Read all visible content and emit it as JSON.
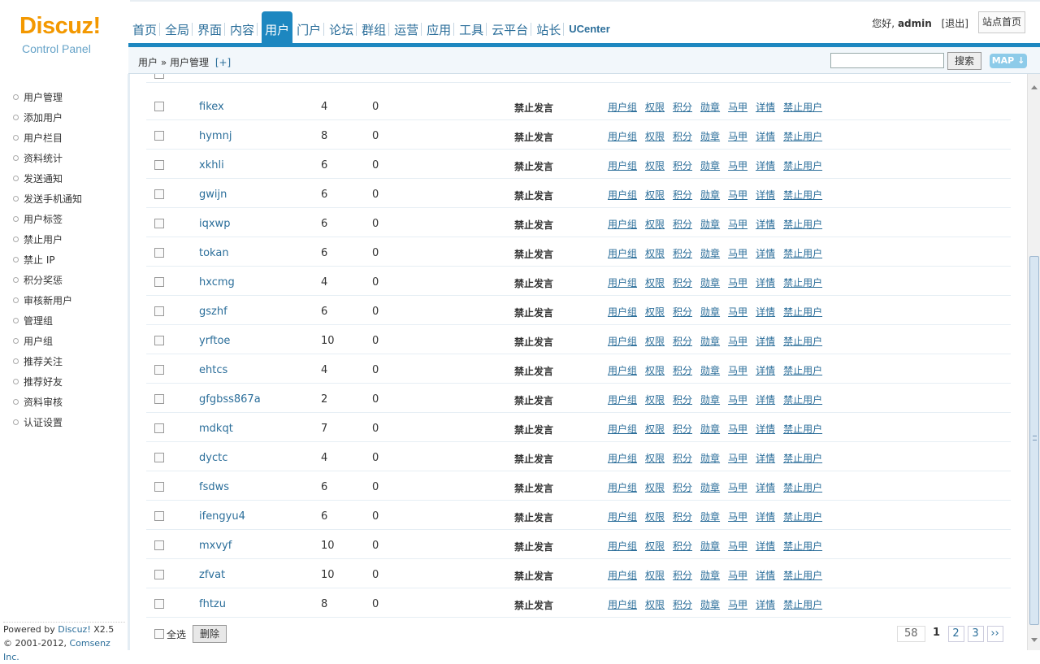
{
  "logo": {
    "brand": "Discuz!",
    "subtitle": "Control Panel"
  },
  "nav": [
    {
      "label": "首页"
    },
    {
      "label": "全局"
    },
    {
      "label": "界面"
    },
    {
      "label": "内容"
    },
    {
      "label": "用户",
      "active": true
    },
    {
      "label": "门户"
    },
    {
      "label": "论坛"
    },
    {
      "label": "群组"
    },
    {
      "label": "运营"
    },
    {
      "label": "应用"
    },
    {
      "label": "工具"
    },
    {
      "label": "云平台"
    },
    {
      "label": "站长"
    },
    {
      "label": "UCenter"
    }
  ],
  "user": {
    "greeting": "您好,",
    "name": "admin",
    "logout": "[退出]",
    "site_home": "站点首页"
  },
  "breadcrumb": {
    "path": "用户 » 用户管理",
    "add": "[+]"
  },
  "search": {
    "button": "搜索",
    "map": "MAP"
  },
  "left_menu": [
    "用户管理",
    "添加用户",
    "用户栏目",
    "资料统计",
    "发送通知",
    "发送手机通知",
    "用户标签",
    "禁止用户",
    "禁止 IP",
    "积分奖惩",
    "审核新用户",
    "管理组",
    "用户组",
    "推荐关注",
    "推荐好友",
    "资料审核",
    "认证设置"
  ],
  "powered": {
    "line1_prefix": "Powered by ",
    "product": "Discuz!",
    "version": " X2.5",
    "line2_prefix": "© 2001-2012, ",
    "company": "Comsenz Inc."
  },
  "ops_labels": [
    "用户组",
    "权限",
    "积分",
    "勋章",
    "马甲",
    "详情",
    "禁止用户"
  ],
  "rows": [
    {
      "name": "fikex",
      "c1": "4",
      "c2": "0",
      "status": "禁止发言"
    },
    {
      "name": "hymnj",
      "c1": "8",
      "c2": "0",
      "status": "禁止发言"
    },
    {
      "name": "xkhli",
      "c1": "6",
      "c2": "0",
      "status": "禁止发言"
    },
    {
      "name": "gwijn",
      "c1": "6",
      "c2": "0",
      "status": "禁止发言"
    },
    {
      "name": "iqxwp",
      "c1": "6",
      "c2": "0",
      "status": "禁止发言"
    },
    {
      "name": "tokan",
      "c1": "6",
      "c2": "0",
      "status": "禁止发言"
    },
    {
      "name": "hxcmg",
      "c1": "4",
      "c2": "0",
      "status": "禁止发言"
    },
    {
      "name": "gszhf",
      "c1": "6",
      "c2": "0",
      "status": "禁止发言"
    },
    {
      "name": "yrftoe",
      "c1": "10",
      "c2": "0",
      "status": "禁止发言"
    },
    {
      "name": "ehtcs",
      "c1": "4",
      "c2": "0",
      "status": "禁止发言"
    },
    {
      "name": "gfgbss867a",
      "c1": "2",
      "c2": "0",
      "status": "禁止发言"
    },
    {
      "name": "mdkqt",
      "c1": "7",
      "c2": "0",
      "status": "禁止发言"
    },
    {
      "name": "dyctc",
      "c1": "4",
      "c2": "0",
      "status": "禁止发言"
    },
    {
      "name": "fsdws",
      "c1": "6",
      "c2": "0",
      "status": "禁止发言"
    },
    {
      "name": "ifengyu4",
      "c1": "6",
      "c2": "0",
      "status": "禁止发言"
    },
    {
      "name": "mxvyf",
      "c1": "10",
      "c2": "0",
      "status": "禁止发言"
    },
    {
      "name": "zfvat",
      "c1": "10",
      "c2": "0",
      "status": "禁止发言"
    },
    {
      "name": "fhtzu",
      "c1": "8",
      "c2": "0",
      "status": "禁止发言"
    }
  ],
  "footer": {
    "select_all": "全选",
    "delete": "删除"
  },
  "pager": {
    "total": "58",
    "current": "1",
    "pages": [
      "2",
      "3"
    ],
    "next": "››"
  },
  "colors": {
    "accent": "#1d87c0",
    "link": "#2b6e9a",
    "logo": "#f39800"
  }
}
